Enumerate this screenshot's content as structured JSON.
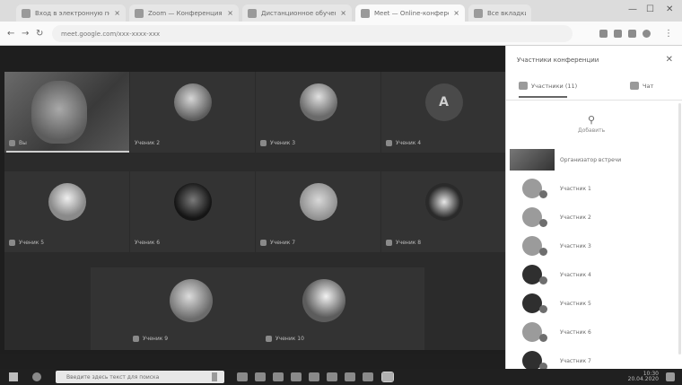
{
  "browser": {
    "tabs": [
      {
        "title": "Вход в электронную почту — Почта Mail.ru"
      },
      {
        "title": "Zoom — Конференция"
      },
      {
        "title": "Дистанционное обучение — Онлайн"
      },
      {
        "title": "Meet — Online-конференция"
      },
      {
        "title": "Все вкладки"
      }
    ],
    "url": "meet.google.com/xxx-xxxx-xxx"
  },
  "grid": {
    "self": {
      "name": "Вы"
    },
    "tiles": [
      {
        "name": "Ученик 2",
        "avatar": "photo"
      },
      {
        "name": "Ученик 3",
        "avatar": "photo"
      },
      {
        "name": "Ученик 4",
        "avatar": "letter",
        "letter": "А"
      },
      {
        "name": "Ученик 5",
        "avatar": "photo"
      },
      {
        "name": "Ученик 6",
        "avatar": "photo"
      },
      {
        "name": "Ученик 7",
        "avatar": "photo"
      },
      {
        "name": "Ученик 8",
        "avatar": "photo"
      },
      {
        "name": "Ученик 9",
        "avatar": "photo"
      },
      {
        "name": "Ученик 10",
        "avatar": "photo"
      }
    ]
  },
  "panel": {
    "title": "Участники конференции",
    "tab_people": "Участники (11)",
    "tab_chat": "Чат",
    "add_label": "Добавить",
    "participants": [
      {
        "name": "Организатор встречи",
        "thumb": true
      },
      {
        "name": "Участник 1",
        "avatar": "light"
      },
      {
        "name": "Участник 2",
        "avatar": "light"
      },
      {
        "name": "Участник 3",
        "avatar": "light"
      },
      {
        "name": "Участник 4",
        "avatar": "dark"
      },
      {
        "name": "Участник 5",
        "avatar": "dark"
      },
      {
        "name": "Участник 6",
        "avatar": "light"
      },
      {
        "name": "Участник 7",
        "avatar": "dark"
      }
    ]
  },
  "taskbar": {
    "search_placeholder": "Введите здесь текст для поиска",
    "time": "10:30",
    "date": "20.04.2020"
  }
}
